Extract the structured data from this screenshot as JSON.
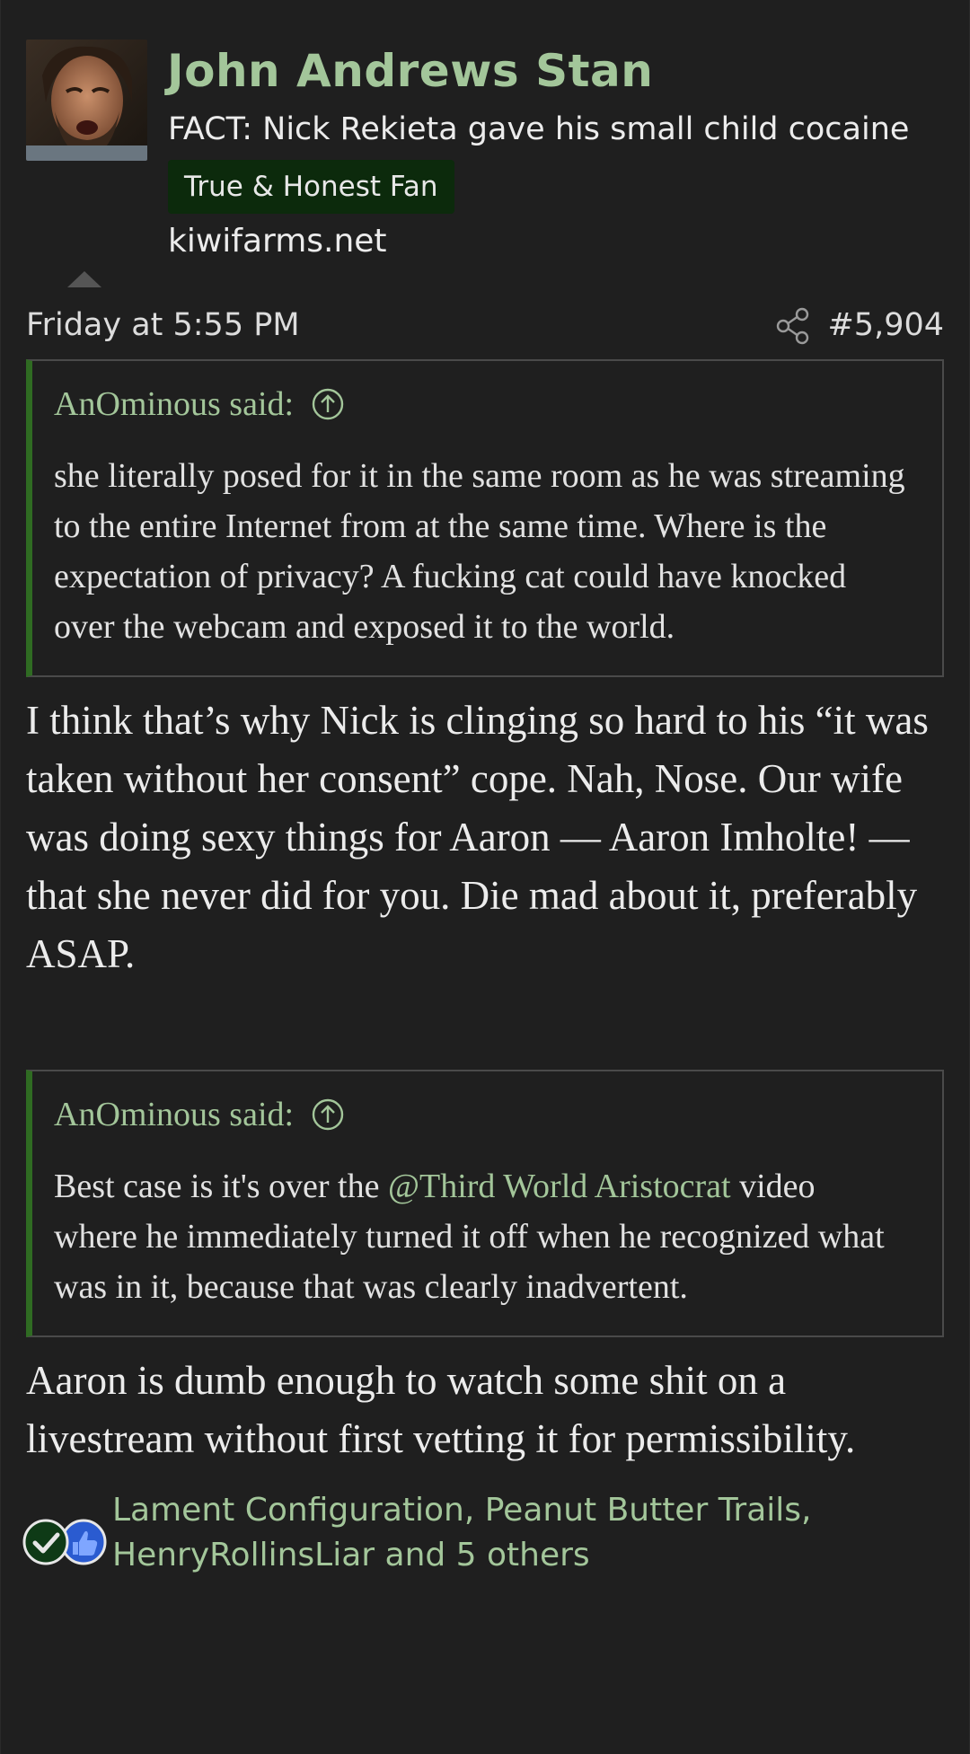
{
  "post": {
    "author": {
      "name": "John Andrews Stan",
      "title": "FACT: Nick Rekieta gave his small child cocaine",
      "badge": "True & Honest Fan",
      "site": "kiwifarms.net",
      "avatar_icon": "user-avatar-photo"
    },
    "date": "Friday at 5:55 PM",
    "number": "#5,904",
    "share_icon": "share-icon",
    "quotes": [
      {
        "author": "AnOminous said:",
        "jump_icon": "arrow-up-circle-icon",
        "body": "she literally posed for it in the same room as he was streaming to the entire Internet from at the same time. Where is the expectation of privacy? A fucking cat could have knocked over the webcam and exposed it to the world."
      },
      {
        "author": "AnOminous said:",
        "jump_icon": "arrow-up-circle-icon",
        "body_before": "Best case is it's over the ",
        "mention": "@Third World Aristocrat",
        "body_after": " video where he immediately turned it off when he recognized what was in it, because that was clearly inadvertent."
      }
    ],
    "replies": [
      "I think that’s why Nick is clinging so hard to his “it was taken without her consent” cope. Nah, Nose. Our wife was doing sexy things for Aaron — Aaron Imholte! — that she never did for you. Die mad about it, preferably ASAP.",
      "Aaron is dumb enough to watch some shit on a livestream without first vetting it for permissibility."
    ],
    "reactions": {
      "icons": [
        "check-reaction-icon",
        "like-reaction-icon"
      ],
      "text": "Lament Configuration, Peanut Butter Trails, HenryRollinsLiar and 5 others"
    }
  },
  "colors": {
    "background": "#1f1f1f",
    "accent_green": "#a3c69a",
    "quote_bar": "#2f6b22",
    "badge_bg": "#0c2a0c",
    "text": "#ececec"
  }
}
